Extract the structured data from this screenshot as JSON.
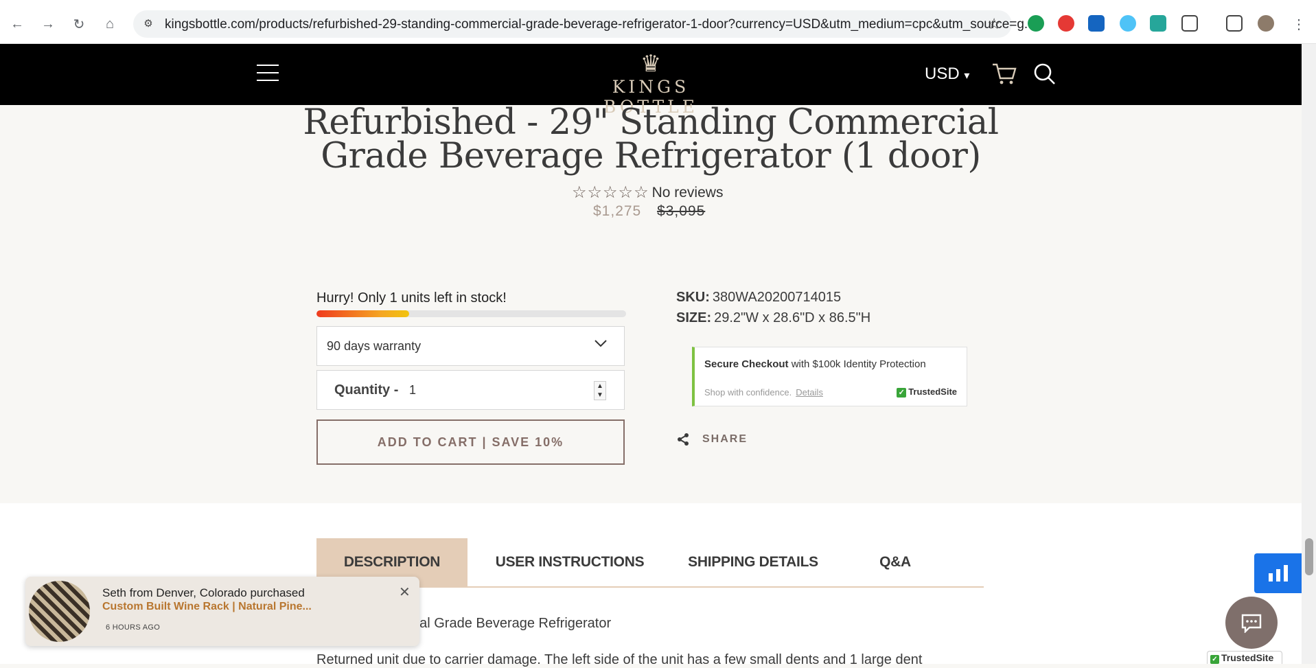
{
  "browser": {
    "url": "kingsbottle.com/products/refurbished-29-standing-commercial-grade-beverage-refrigerator-1-door?currency=USD&utm_medium=cpc&utm_source=g..."
  },
  "header": {
    "logo_text": "KINGS BOTTLE",
    "currency": "USD",
    "colors": {
      "background": "#000000",
      "logo": "#d8cbb8"
    }
  },
  "product": {
    "title_line1": "Refurbished - 29\" Standing Commercial",
    "title_line2": "Grade Beverage Refrigerator (1 door)",
    "stars": "☆☆☆☆☆",
    "reviews_label": "No reviews",
    "sale_price": "$1,275",
    "compare_price": "$3,095",
    "stock_message": "Hurry! Only 1 units left in stock!",
    "stock_level_fraction": 0.3,
    "warranty_selected": "90 days warranty",
    "quantity_label": "Quantity",
    "quantity_sep": "-",
    "quantity_value": "1",
    "add_to_cart_label": "ADD TO CART | SAVE 10%",
    "sku_label": "SKU:",
    "sku_value": "380WA20200714015",
    "size_label": "SIZE:",
    "size_value": "29.2\"W x 28.6\"D x 86.5\"H",
    "share_label": "SHARE"
  },
  "secure_checkout": {
    "title_bold": "Secure Checkout",
    "title_rest": " with $100k Identity Protection",
    "confidence": "Shop with confidence.",
    "details_link": "Details",
    "badge": "TrustedSite"
  },
  "tabs": [
    {
      "label": "DESCRIPTION",
      "active": true
    },
    {
      "label": "USER INSTRUCTIONS",
      "active": false
    },
    {
      "label": "SHIPPING DETAILS",
      "active": false
    },
    {
      "label": "Q&A",
      "active": false
    }
  ],
  "description": {
    "line1": "rcial Grade Beverage Refrigerator",
    "line2": "Returned unit due to carrier damage. The left side of the unit has a few small dents and 1 large dent"
  },
  "popup": {
    "who": "Seth from Denver, Colorado purchased",
    "product": "Custom Built Wine Rack | Natural Pine...",
    "time": "6 HOURS AGO"
  },
  "trusted_badge": "TrustedSite",
  "accent_colors": {
    "cta_border": "#856e68",
    "active_tab": "#e4cdb7",
    "secure_bar": "#7ec242"
  }
}
